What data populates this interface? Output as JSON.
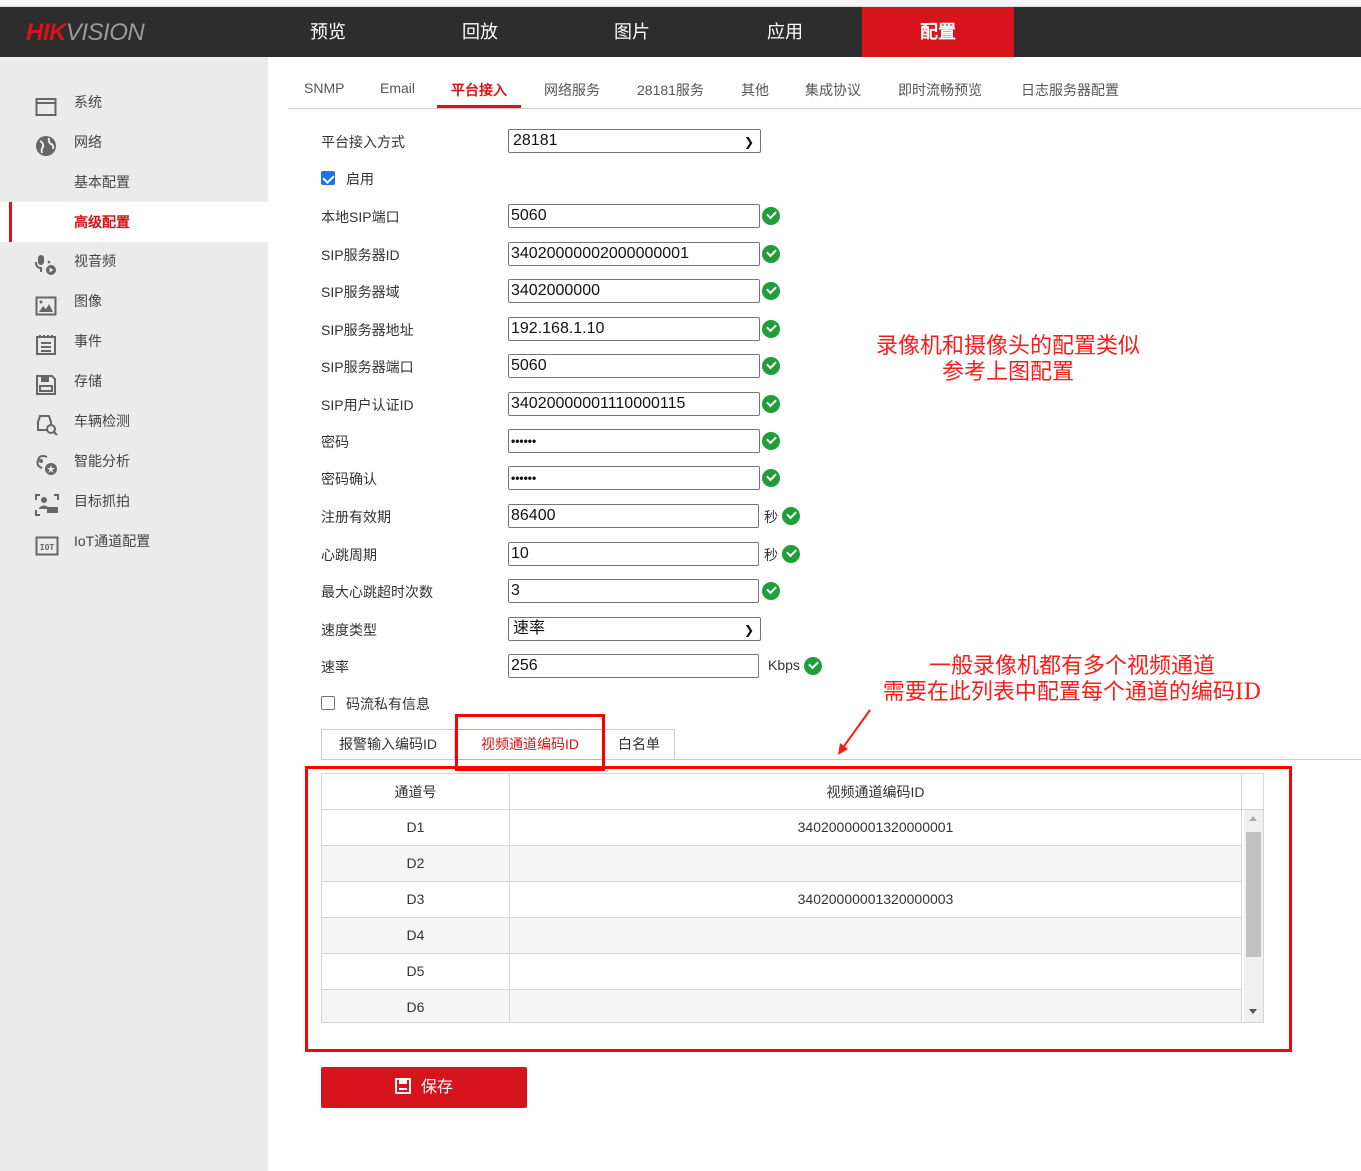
{
  "brand": {
    "logo_red": "HIK",
    "logo_gray": "VISION"
  },
  "topnav": [
    {
      "label": "预览",
      "active": false
    },
    {
      "label": "回放",
      "active": false
    },
    {
      "label": "图片",
      "active": false
    },
    {
      "label": "应用",
      "active": false
    },
    {
      "label": "配置",
      "active": true
    }
  ],
  "sidebar": {
    "items": [
      {
        "label": "系统",
        "icon": "window-icon"
      },
      {
        "label": "网络",
        "icon": "globe-icon"
      },
      {
        "label": "基本配置",
        "icon": null
      },
      {
        "label": "高级配置",
        "icon": null,
        "active": true
      },
      {
        "label": "视音频",
        "icon": "mic-play-icon"
      },
      {
        "label": "图像",
        "icon": "image-icon"
      },
      {
        "label": "事件",
        "icon": "calendar-icon"
      },
      {
        "label": "存储",
        "icon": "floppy-icon"
      },
      {
        "label": "车辆检测",
        "icon": "car-search-icon"
      },
      {
        "label": "智能分析",
        "icon": "smart-analysis-icon"
      },
      {
        "label": "目标抓拍",
        "icon": "target-capture-icon"
      },
      {
        "label": "IoT通道配置",
        "icon": "iot-icon"
      }
    ]
  },
  "subtabs": [
    {
      "label": "SNMP"
    },
    {
      "label": "Email"
    },
    {
      "label": "平台接入",
      "active": true
    },
    {
      "label": "网络服务"
    },
    {
      "label": "28181服务"
    },
    {
      "label": "其他"
    },
    {
      "label": "集成协议"
    },
    {
      "label": "即时流畅预览"
    },
    {
      "label": "日志服务器配置"
    }
  ],
  "form": {
    "access_mode": {
      "label": "平台接入方式",
      "value": "28181"
    },
    "enable": {
      "label": "启用",
      "checked": true
    },
    "local_sip_port": {
      "label": "本地SIP端口",
      "value": "5060"
    },
    "sip_server_id": {
      "label": "SIP服务器ID",
      "value": "34020000002000000001"
    },
    "sip_server_domain": {
      "label": "SIP服务器域",
      "value": "3402000000"
    },
    "sip_server_addr": {
      "label": "SIP服务器地址",
      "value": "192.168.1.10"
    },
    "sip_server_port": {
      "label": "SIP服务器端口",
      "value": "5060"
    },
    "sip_user_auth_id": {
      "label": "SIP用户认证ID",
      "value": "34020000001110000115"
    },
    "password": {
      "label": "密码",
      "value": "••••••"
    },
    "password_confirm": {
      "label": "密码确认",
      "value": "••••••"
    },
    "register_expiry": {
      "label": "注册有效期",
      "value": "86400",
      "unit": "秒"
    },
    "heartbeat_period": {
      "label": "心跳周期",
      "value": "10",
      "unit": "秒"
    },
    "max_heartbeat_timeout": {
      "label": "最大心跳超时次数",
      "value": "3"
    },
    "speed_type": {
      "label": "速度类型",
      "value": "速率"
    },
    "rate": {
      "label": "速率",
      "value": "256",
      "unit": "Kbps"
    },
    "stream_private_info": {
      "label": "码流私有信息",
      "checked": false
    }
  },
  "code_tabs": [
    {
      "label": "报警输入编码ID"
    },
    {
      "label": "视频通道编码ID",
      "active": true
    },
    {
      "label": "白名单"
    }
  ],
  "table": {
    "headers": [
      "通道号",
      "视频通道编码ID"
    ],
    "rows": [
      {
        "channel": "D1",
        "code": "34020000001320000001"
      },
      {
        "channel": "D2",
        "code": ""
      },
      {
        "channel": "D3",
        "code": "34020000001320000003"
      },
      {
        "channel": "D4",
        "code": ""
      },
      {
        "channel": "D5",
        "code": ""
      },
      {
        "channel": "D6",
        "code": ""
      }
    ]
  },
  "save_label": "保存",
  "annotations": {
    "note1_line1": "录像机和摄像头的配置类似",
    "note1_line2": "参考上图配置",
    "note2_line1": "一般录像机都有多个视频通道",
    "note2_line2": "需要在此列表中配置每个通道的编码ID"
  },
  "colors": {
    "brand_red": "#d7141b",
    "ok_green": "#1f9e3a",
    "annotation_red": "#ff0000"
  }
}
